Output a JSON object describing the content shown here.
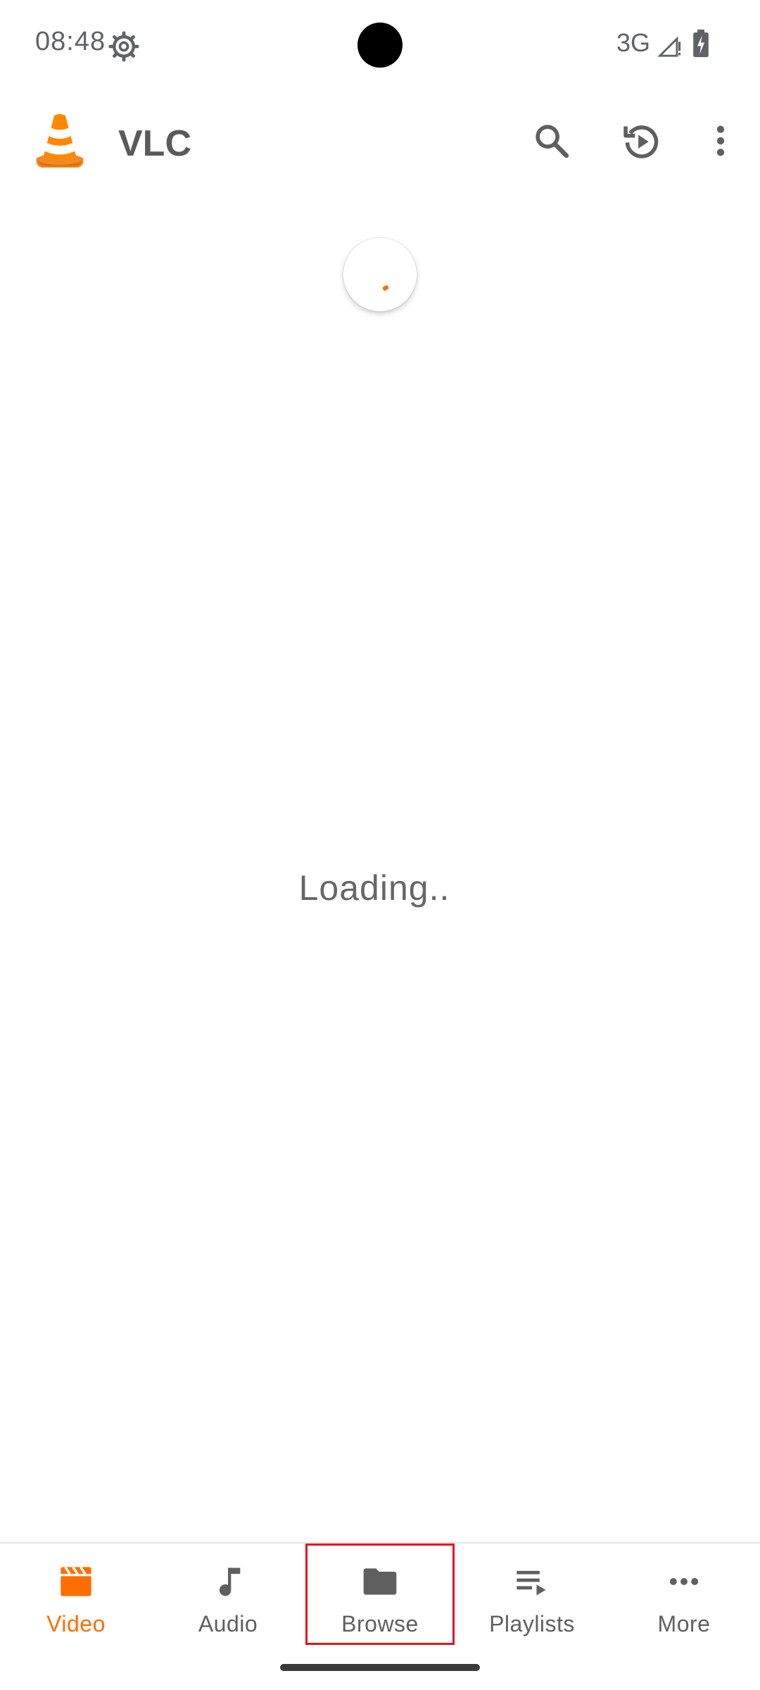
{
  "status_bar": {
    "time": "08:48",
    "network": "3G",
    "icons": [
      "settings-gear-icon",
      "signal-icon",
      "battery-charging-icon"
    ]
  },
  "app_bar": {
    "title": "VLC",
    "logo": "vlc-cone-icon",
    "actions": [
      "search-icon",
      "history-play-icon",
      "more-vert-icon"
    ]
  },
  "main": {
    "loading_text": "Loading.."
  },
  "bottom_nav": {
    "items": [
      {
        "label": "Video",
        "icon": "video-clapper-icon",
        "active": true
      },
      {
        "label": "Audio",
        "icon": "music-note-icon",
        "active": false
      },
      {
        "label": "Browse",
        "icon": "folder-icon",
        "active": false
      },
      {
        "label": "Playlists",
        "icon": "playlist-icon",
        "active": false
      },
      {
        "label": "More",
        "icon": "more-horiz-icon",
        "active": false
      }
    ],
    "highlighted": "Browse"
  },
  "colors": {
    "accent": "#ff6d00",
    "text_secondary": "#5f5f5f",
    "highlight": "#e8141b"
  }
}
